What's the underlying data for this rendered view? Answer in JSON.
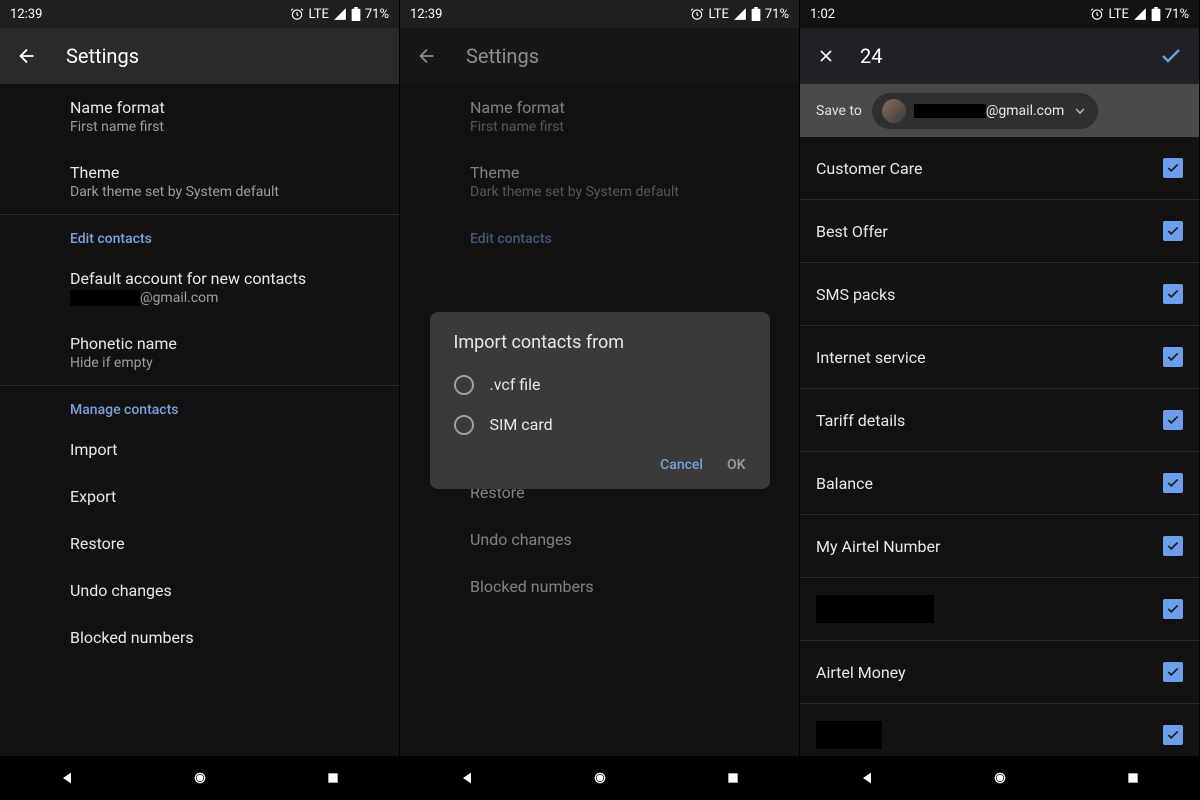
{
  "screen1": {
    "status": {
      "time": "12:39",
      "network": "LTE",
      "battery": "71%"
    },
    "title": "Settings",
    "rows": [
      {
        "primary": "Name format",
        "secondary": "First name first"
      },
      {
        "primary": "Theme",
        "secondary": "Dark theme set by System default"
      }
    ],
    "edit_section": "Edit contacts",
    "edit_rows": [
      {
        "primary": "Default account for new contacts",
        "secondary_suffix": "@gmail.com"
      },
      {
        "primary": "Phonetic name",
        "secondary": "Hide if empty"
      }
    ],
    "manage_section": "Manage contacts",
    "manage_rows": [
      "Import",
      "Export",
      "Restore",
      "Undo changes",
      "Blocked numbers"
    ]
  },
  "screen2": {
    "status": {
      "time": "12:39",
      "network": "LTE",
      "battery": "71%"
    },
    "title": "Settings",
    "dialog": {
      "title": "Import contacts from",
      "options": [
        ".vcf file",
        "SIM card"
      ],
      "cancel": "Cancel",
      "ok": "OK"
    }
  },
  "screen3": {
    "status": {
      "time": "1:02",
      "network": "LTE",
      "battery": "71%"
    },
    "count": "24",
    "saveto_label": "Save to",
    "account_suffix": "@gmail.com",
    "contacts": [
      {
        "name": "Customer Care",
        "checked": true
      },
      {
        "name": "Best Offer",
        "checked": true
      },
      {
        "name": "SMS packs",
        "checked": true
      },
      {
        "name": "Internet service",
        "checked": true
      },
      {
        "name": "Tariff details",
        "checked": true
      },
      {
        "name": "Balance",
        "checked": true
      },
      {
        "name": "My Airtel Number",
        "checked": true
      },
      {
        "name": "",
        "checked": true,
        "redacted": true,
        "redactWidth": 118
      },
      {
        "name": "Airtel Money",
        "checked": true
      },
      {
        "name": "",
        "checked": true,
        "redacted": true,
        "redactWidth": 66
      }
    ]
  }
}
